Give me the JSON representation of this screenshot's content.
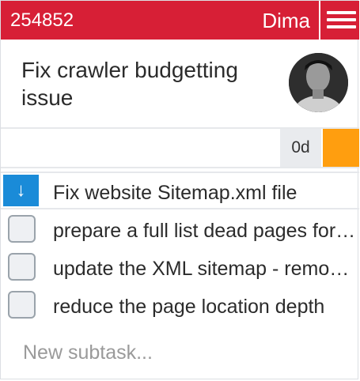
{
  "header": {
    "task_id": "254852",
    "assignee": "Dima",
    "menu_icon": "hamburger-menu-icon",
    "color": "#d71f36"
  },
  "task": {
    "title": "Fix crawler budgetting issue",
    "avatar_icon": "user-avatar"
  },
  "meta": {
    "duration": "0d",
    "priority_color": "#ff9e0f"
  },
  "subtasks": {
    "main": {
      "label": "Fix website Sitemap.xml file",
      "icon": "arrow-down-icon"
    },
    "items": [
      {
        "label": "prepare a full list dead pages for removal"
      },
      {
        "label": "update the XML sitemap - remove dead pages"
      },
      {
        "label": "reduce the page location depth"
      }
    ],
    "new_placeholder": "New subtask..."
  }
}
